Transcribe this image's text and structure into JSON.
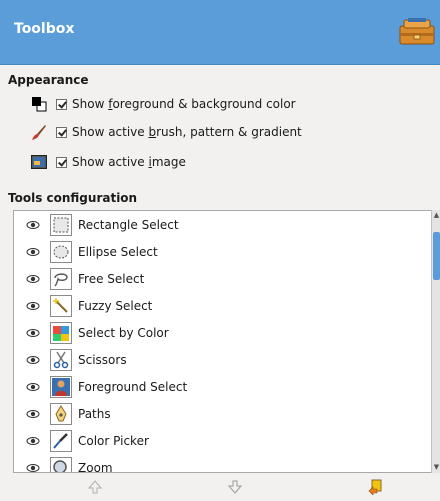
{
  "header": {
    "title": "Toolbox",
    "icon": "toolbox-icon"
  },
  "appearance": {
    "title": "Appearance",
    "options": [
      {
        "pre": "Show ",
        "accel": "f",
        "post": "oreground & background color",
        "checked": true,
        "icon": "fg-bg-color-icon"
      },
      {
        "pre": "Show active ",
        "accel": "b",
        "post": "rush, pattern & gradient",
        "checked": true,
        "icon": "brush-icon"
      },
      {
        "pre": "Show active ",
        "accel": "i",
        "post": "mage",
        "checked": true,
        "icon": "active-image-icon"
      }
    ]
  },
  "tools": {
    "title": "Tools configuration",
    "items": [
      {
        "label": "Rectangle Select",
        "visible": true,
        "icon": "rect-select-icon"
      },
      {
        "label": "Ellipse Select",
        "visible": true,
        "icon": "ellipse-select-icon"
      },
      {
        "label": "Free Select",
        "visible": true,
        "icon": "lasso-icon"
      },
      {
        "label": "Fuzzy Select",
        "visible": true,
        "icon": "magic-wand-icon"
      },
      {
        "label": "Select by Color",
        "visible": true,
        "icon": "select-by-color-icon"
      },
      {
        "label": "Scissors",
        "visible": true,
        "icon": "scissors-icon"
      },
      {
        "label": "Foreground Select",
        "visible": true,
        "icon": "foreground-select-icon"
      },
      {
        "label": "Paths",
        "visible": true,
        "icon": "paths-icon"
      },
      {
        "label": "Color Picker",
        "visible": true,
        "icon": "color-picker-icon"
      },
      {
        "label": "Zoom",
        "visible": true,
        "icon": "zoom-icon"
      }
    ]
  },
  "footer": {
    "buttons": [
      "raise-tool-icon",
      "lower-tool-icon",
      "reset-tools-icon"
    ]
  },
  "colors": {
    "header": "#5b9dd9",
    "accent": "#5b9dd9"
  }
}
